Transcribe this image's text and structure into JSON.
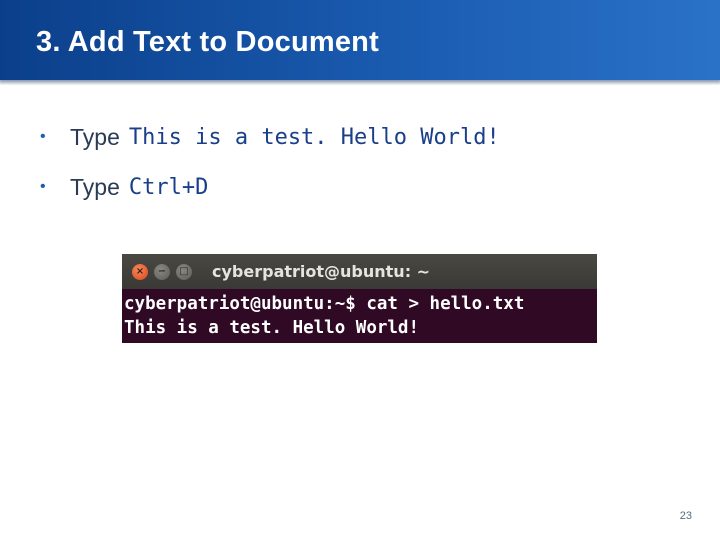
{
  "slide": {
    "title": "3. Add Text to Document",
    "page_number": "23"
  },
  "bullets": [
    {
      "symbol": "•",
      "text": "Type",
      "code": "This is a test. Hello World!"
    },
    {
      "symbol": "•",
      "text": "Type",
      "code": "Ctrl+D"
    }
  ],
  "terminal": {
    "window_title": "cyberpatriot@ubuntu: ~",
    "buttons": {
      "close": "×",
      "minimize": "−",
      "maximize": "□"
    },
    "lines": [
      "cyberpatriot@ubuntu:~$ cat > hello.txt",
      "This is a test. Hello World!"
    ]
  },
  "colors": {
    "title_bar": "#1a5bb0",
    "terminal_background": "#300a24",
    "code_text": "#1a3f8a",
    "close_button": "#d9441b"
  },
  "icons": {
    "bullet": "bullet-dot-icon",
    "close": "close-icon",
    "minimize": "minimize-icon",
    "maximize": "maximize-icon"
  }
}
